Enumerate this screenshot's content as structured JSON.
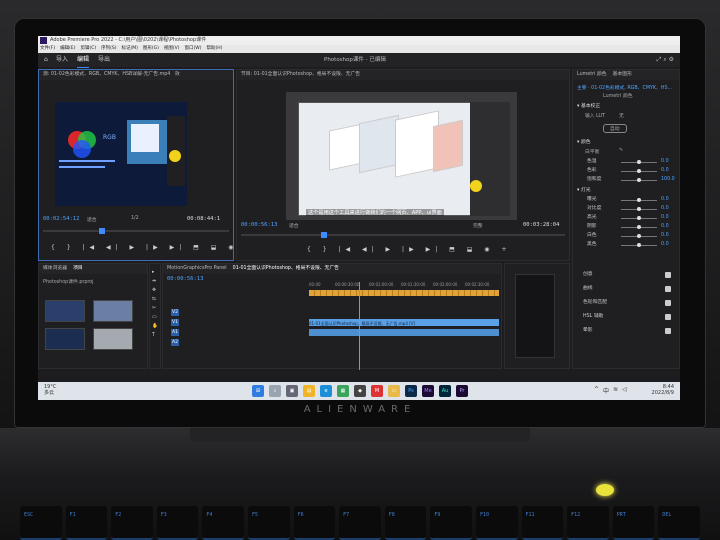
{
  "app": {
    "title": "Adobe Premiere Pro 2022 - C:\\用户\\图\\0202\\课程\\Photoshop课件",
    "menu": [
      "文件(F)",
      "编辑(E)",
      "剪辑(C)",
      "序列(S)",
      "标记(M)",
      "图形(G)",
      "视图(V)",
      "窗口(W)",
      "帮助(H)"
    ],
    "workspace_tabs": [
      "导入",
      "编辑",
      "导出"
    ],
    "active_workspace": "编辑",
    "project_name": "Photoshop课件 - 已编辑"
  },
  "source_panel": {
    "tab_label": "源: 01-02色彩模式、RGB、CMYK、HSB详解-无广告.mp4",
    "tab_label_2": "效",
    "video_text_rgb": "RGB",
    "timecode_current": "00:02:54:12",
    "fit_label": "适合",
    "zoom": "1/2",
    "timecode_duration": "00:08:44:1"
  },
  "program_panel": {
    "tab_label": "节目: 01-01全面认识Photoshop、格局不设限、无广告",
    "subtitle": "这个是用这个工具来进行做我们的一个网页、APP、ui界面",
    "timecode_current": "00:00:56:13",
    "fit_label": "适合",
    "quality_label": "完整",
    "timecode_duration": "00:03:28:04"
  },
  "lumetri": {
    "tab_label": "Lumetri 颜色",
    "tab_label_2": "基本图形",
    "clip_label": "主要 · 01-02色彩模式, RGB、CMYK、HS...",
    "clip_label_2": "Lumetri 颜色",
    "section_basic": "基本校正",
    "input_lut_label": "输入 LUT",
    "input_lut_value": "无",
    "auto_button": "自动",
    "color_section": "颜色",
    "white_balance": "白平衡",
    "color_rows": [
      {
        "label": "色温",
        "value": "0.0"
      },
      {
        "label": "色彩",
        "value": "0.0"
      },
      {
        "label": "饱和度",
        "value": "100.0"
      }
    ],
    "light_section": "灯光",
    "light_rows": [
      {
        "label": "曝光",
        "value": "0.0"
      },
      {
        "label": "对比度",
        "value": "0.0"
      },
      {
        "label": "高光",
        "value": "0.0"
      },
      {
        "label": "阴影",
        "value": "0.0"
      },
      {
        "label": "白色",
        "value": "0.0"
      },
      {
        "label": "黑色",
        "value": "0.0"
      }
    ],
    "checks": [
      "创意",
      "曲线",
      "色轮和匹配",
      "HSL 辅助",
      "晕影"
    ]
  },
  "project_panel": {
    "tab_label": "媒体浏览器",
    "tab_active": "项目",
    "bin_label": "Photoshop课件.prproj"
  },
  "timeline": {
    "sequence_tab": "MotionGraphicsPro Panel",
    "sequence_tab_2": "01-01全面认识Photoshop、格局不设限、无广告",
    "timecode": "00:00:56:13",
    "ruler": [
      "00:00",
      "00:00:30:00",
      "00:01:00:00",
      "00:01:30:00",
      "00:02:00:00",
      "00:02:30:00",
      "00:03:00:00"
    ],
    "tracks": [
      "V2",
      "V1",
      "A1",
      "A2"
    ],
    "clip_label": "01-01全面认识Photoshop、格局不设限、无广告.mp4 [V]"
  },
  "taskbar": {
    "temperature": "19°C",
    "weather_text": "多云",
    "apps": [
      "Ps",
      "Me",
      "Au",
      "Pr"
    ],
    "time": "8:44",
    "date": "2022/8/9",
    "ime": "中"
  },
  "laptop": {
    "brand": "ALIENWARE",
    "keys": [
      "ESC",
      "F1",
      "F2",
      "F3",
      "F4",
      "F5",
      "F6",
      "F7",
      "F8",
      "F9",
      "F10",
      "F11",
      "F12",
      "PRT",
      "DEL"
    ]
  },
  "colors": {
    "accent": "#3d8cff",
    "alien_logo": "#e8e23a",
    "cursor": "#f2d31b",
    "audio_clip": "#e0a33a",
    "video_clip": "#5aa0e6"
  }
}
